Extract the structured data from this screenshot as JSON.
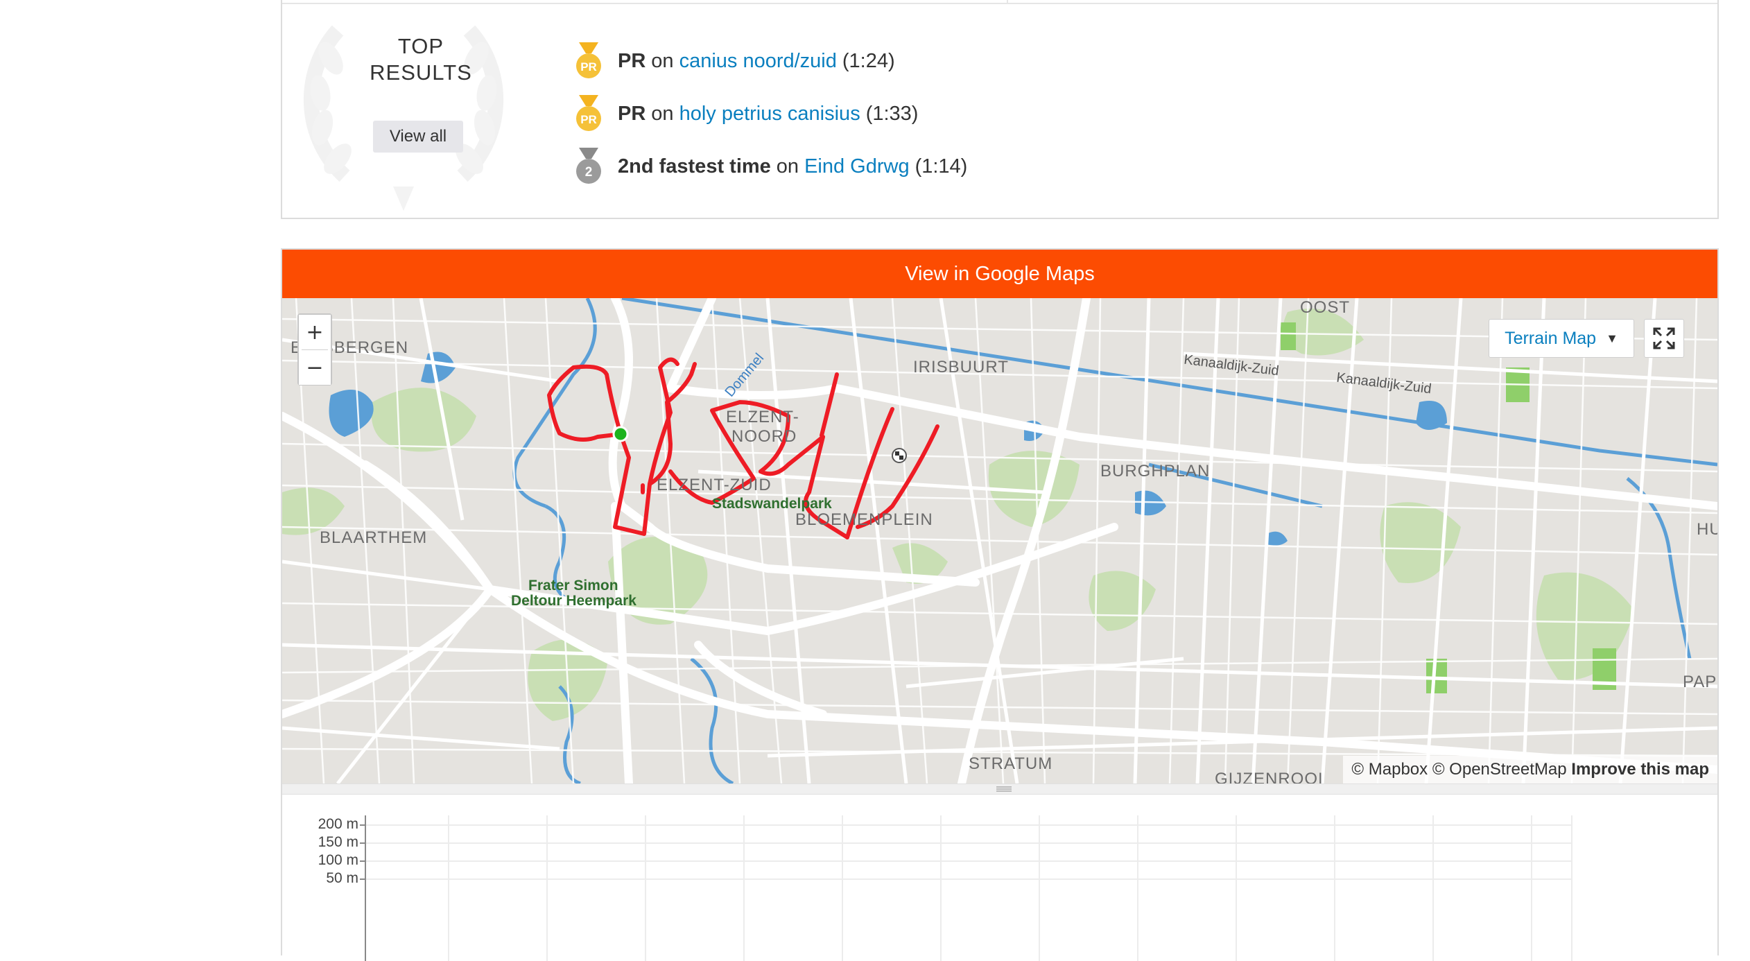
{
  "top_results": {
    "title_line1": "TOP",
    "title_line2": "RESULTS",
    "view_all_label": "View all",
    "items": [
      {
        "medal": "PR",
        "medal_icon": "pr-medal-icon",
        "lead": "PR",
        "on": "on",
        "segment": "canius noord/zuid",
        "time": "(1:24)"
      },
      {
        "medal": "PR",
        "medal_icon": "pr-medal-icon",
        "lead": "PR",
        "on": "on",
        "segment": "holy petrius canisius",
        "time": "(1:33)"
      },
      {
        "medal": "2",
        "medal_icon": "silver-medal-icon",
        "lead": "2nd fastest time",
        "on": "on",
        "segment": "Eind Gdrwg",
        "time": "(1:14)"
      }
    ]
  },
  "map": {
    "google_maps_label": "View in Google Maps",
    "zoom_in": "+",
    "zoom_out": "−",
    "layer_selected": "Terrain Map",
    "attribution": {
      "mapbox": "© Mapbox",
      "osm": "© OpenStreetMap",
      "improve": "Improve this map"
    },
    "labels": {
      "oost": "OOST",
      "ellsbergen": "ELLSBERGEN",
      "irisbuurt": "IRISBUURT",
      "kanaaldijk1": "Kanaaldijk-Zuid",
      "kanaaldijk2": "Kanaaldijk-Zuid",
      "dommel": "Dommel",
      "elzent_noord_1": "ELZENT-",
      "elzent_noord_2": "NOORD",
      "elzent_zuid": "ELZENT-ZUID",
      "stadswandelpark": "Stadswandelpark",
      "bloemenplein": "BLOEMENPLEIN",
      "burghplan": "BURGHPLAN",
      "blaarthem": "BLAARTHEM",
      "frater_1": "Frater Simon",
      "frater_2": "Deltour Heempark",
      "stratum": "STRATUM",
      "gijzenrooi": "GIJZENROOI",
      "hu": "HU",
      "pape": "PAPE"
    },
    "colors": {
      "accent": "#fc4c02",
      "route": "#ee1c25",
      "start": "#1db31d",
      "link": "#0a7fbf",
      "water": "#5b9fd6",
      "park": "#c9dfb4"
    }
  },
  "elevation": {
    "y_ticks": [
      "200 m",
      "150 m",
      "100 m",
      "50 m"
    ]
  }
}
